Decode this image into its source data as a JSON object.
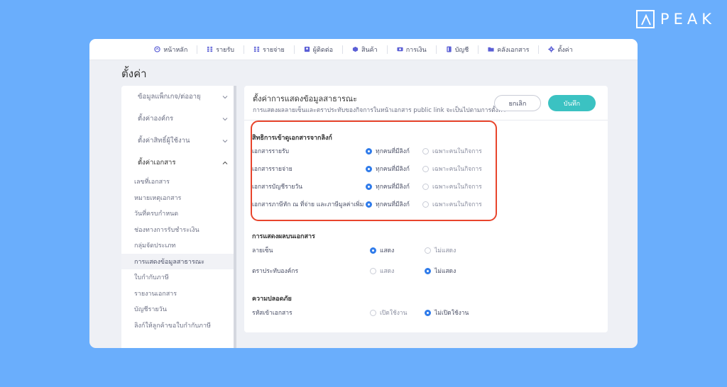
{
  "brand": {
    "name": "PEAK"
  },
  "nav": [
    {
      "label": "หน้าหลัก",
      "icon": "home-icon"
    },
    {
      "label": "รายรับ",
      "icon": "income-icon"
    },
    {
      "label": "รายจ่าย",
      "icon": "expense-icon"
    },
    {
      "label": "ผู้ติดต่อ",
      "icon": "contacts-icon"
    },
    {
      "label": "สินค้า",
      "icon": "product-icon"
    },
    {
      "label": "การเงิน",
      "icon": "finance-icon"
    },
    {
      "label": "บัญชี",
      "icon": "accounting-icon"
    },
    {
      "label": "คลังเอกสาร",
      "icon": "folder-icon"
    },
    {
      "label": "ตั้งค่า",
      "icon": "gear-icon"
    }
  ],
  "page": {
    "title": "ตั้งค่า"
  },
  "sidebar": {
    "groups": [
      {
        "label": "ข้อมูลแพ็กเกจ/ต่ออายุ"
      },
      {
        "label": "ตั้งค่าองค์กร"
      },
      {
        "label": "ตั้งค่าสิทธิ์ผู้ใช้งาน"
      },
      {
        "label": "ตั้งค่าเอกสาร"
      }
    ],
    "items": [
      {
        "label": "เลขที่เอกสาร"
      },
      {
        "label": "หมายเหตุเอกสาร"
      },
      {
        "label": "วันที่ครบกำหนด"
      },
      {
        "label": "ช่องทางการรับชำระเงิน"
      },
      {
        "label": "กลุ่มจัดประเภท"
      },
      {
        "label": "การแสดงข้อมูลสาธารณะ"
      },
      {
        "label": "ใบกำกับภาษี"
      },
      {
        "label": "รายงานเอกสาร"
      },
      {
        "label": "บัญชีรายวัน"
      },
      {
        "label": "ลิงก์ให้ลูกค้าขอใบกำกับภาษี"
      }
    ]
  },
  "main": {
    "title": "ตั้งค่าการแสดงข้อมูลสาธารณะ",
    "description": "การแสดงผลลายเซ็นและตราประทับของกิจการในหน้าเอกสาร public link จะเป็นไปตามการตั้งค่า",
    "cancel_label": "ยกเลิก",
    "save_label": "บันทึก",
    "access": {
      "title": "สิทธิการเข้าดูเอกสารจากลิงก์",
      "opt_all": "ทุกคนที่มีลิงก์",
      "opt_internal": "เฉพาะคนในกิจการ",
      "rows": [
        {
          "label": "เอกสารรายรับ",
          "selected": "all"
        },
        {
          "label": "เอกสารรายจ่าย",
          "selected": "all"
        },
        {
          "label": "เอกสารบัญชีรายวัน",
          "selected": "all"
        },
        {
          "label": "เอกสารภาษีหัก ณ ที่จ่าย และภาษีมูลค่าเพิ่ม",
          "selected": "all"
        }
      ]
    },
    "display": {
      "title": "การแสดงผลบนเอกสาร",
      "opt_show": "แสดง",
      "opt_hide": "ไม่แสดง",
      "rows": [
        {
          "label": "ลายเซ็น",
          "selected": "show"
        },
        {
          "label": "ตราประทับองค์กร",
          "selected": "hide"
        }
      ]
    },
    "security": {
      "title": "ความปลอดภัย",
      "opt_on": "เปิดใช้งาน",
      "opt_off": "ไม่เปิดใช้งาน",
      "rows": [
        {
          "label": "รหัสเข้าเอกสาร",
          "selected": "off"
        }
      ]
    }
  },
  "colors": {
    "background": "#6aaefc",
    "accent": "#3bc2c2",
    "radio": "#2f7bea",
    "highlight": "#e8452c"
  }
}
